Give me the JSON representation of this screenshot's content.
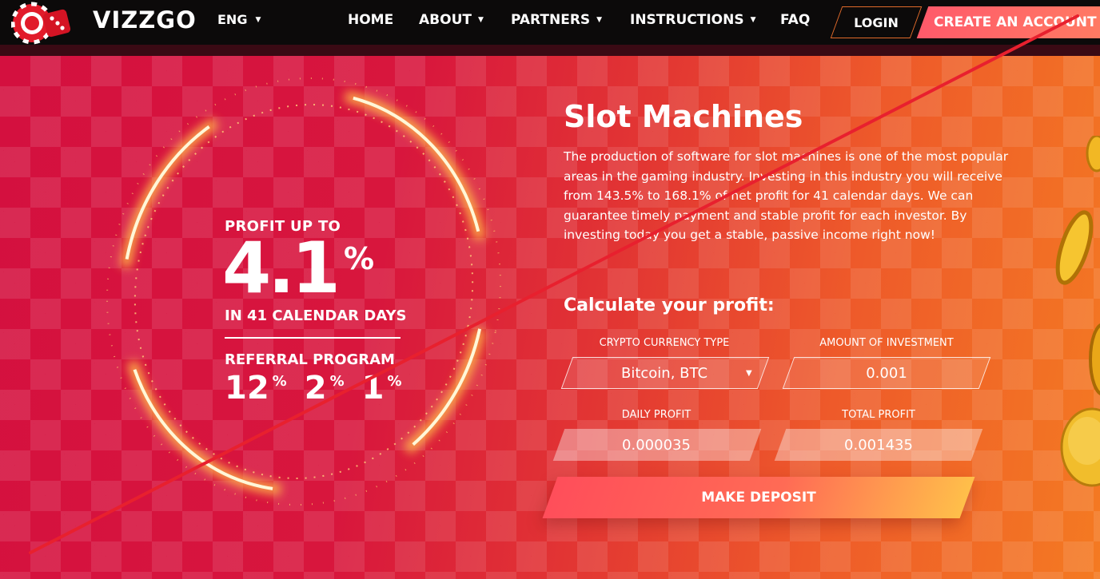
{
  "nav": {
    "brand": "VIZZGO",
    "lang": "ENG",
    "items": [
      "HOME",
      "ABOUT",
      "PARTNERS",
      "INSTRUCTIONS",
      "FAQ"
    ],
    "login": "LOGIN",
    "create": "CREATE AN ACCOUNT"
  },
  "promo": {
    "profit_up": "PROFIT UP TO",
    "value": "4.1",
    "percent": "%",
    "days": "IN 41 CALENDAR DAYS",
    "referral": "REFERRAL PROGRAM",
    "levels": [
      "12",
      "2",
      "1"
    ],
    "level_unit": "%"
  },
  "section": {
    "title": "Slot Machines",
    "description": "The production of software for slot machines is one of the most popular areas in the gaming industry. Investing in this industry you will receive from 143.5% to 168.1% of net profit for 41 calendar days. We can guarantee timely payment and stable profit for each investor. By investing today you get a stable, passive income right now!"
  },
  "calc": {
    "title": "Calculate your profit:",
    "currency_label": "CRYPTO CURRENCY TYPE",
    "currency_value": "Bitcoin, BTC",
    "amount_label": "AMOUNT OF INVESTMENT",
    "amount_value": "0.001",
    "daily_label": "DAILY PROFIT",
    "daily_value": "0.000035",
    "total_label": "TOTAL PROFIT",
    "total_value": "0.001435",
    "deposit": "MAKE DEPOSIT"
  },
  "colors": {
    "nav_bg": "#0c0a0a",
    "hero_left": "#d4103f",
    "hero_right": "#f47a22",
    "cta": "#ff5a6a",
    "strike": "#e8202e"
  }
}
